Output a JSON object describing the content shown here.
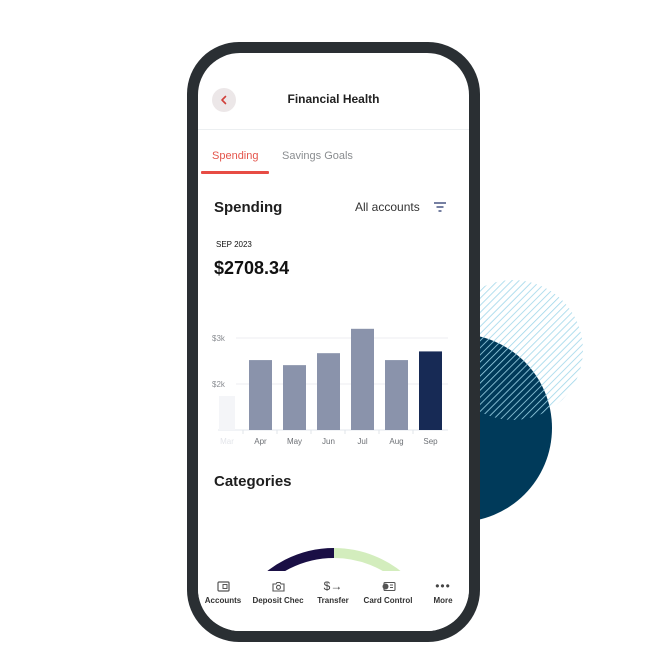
{
  "header": {
    "title": "Financial Health",
    "back_icon": "chevron-left-icon"
  },
  "tabs": [
    {
      "label": "Spending",
      "active": true
    },
    {
      "label": "Savings Goals",
      "active": false
    }
  ],
  "spending": {
    "title": "Spending",
    "account_filter": "All accounts",
    "filter_icon": "filter-icon",
    "period": "SEP 2023",
    "amount": "$2708.34"
  },
  "chart_data": {
    "type": "bar",
    "title": "",
    "xlabel": "",
    "ylabel": "",
    "categories": [
      "Mar",
      "Apr",
      "May",
      "Jun",
      "Jul",
      "Aug",
      "Sep"
    ],
    "values": [
      1740,
      2520,
      2410,
      2670,
      3200,
      2520,
      2708.34
    ],
    "highlighted": "Sep",
    "faded": [
      "Mar"
    ],
    "ytick_labels": [
      "$2k",
      "$3k"
    ],
    "yticks": [
      2000,
      3000
    ],
    "ylim": [
      1000,
      3300
    ],
    "grid": true,
    "colors": {
      "default": "#8a93ab",
      "highlight": "#172a55",
      "faded": "#f4f5f8"
    }
  },
  "categories": {
    "title": "Categories",
    "gauge_segments": [
      {
        "color": "#2c6b96",
        "fraction": 0.2
      },
      {
        "color": "#1a0f45",
        "fraction": 0.3
      },
      {
        "color": "#d3edbd",
        "fraction": 0.5
      }
    ]
  },
  "bottom_nav": [
    {
      "label": "Accounts",
      "icon": "wallet-icon"
    },
    {
      "label": "Deposit Chec",
      "icon": "camera-icon"
    },
    {
      "label": "Transfer",
      "icon": "transfer-icon"
    },
    {
      "label": "Card Control",
      "icon": "card-control-icon"
    },
    {
      "label": "More",
      "icon": "more-icon"
    }
  ],
  "colors": {
    "accent": "#e74c44",
    "phone_frame": "#2a2f33",
    "deco_navy": "#003a5a",
    "deco_hatch": "#9fd6ea"
  }
}
